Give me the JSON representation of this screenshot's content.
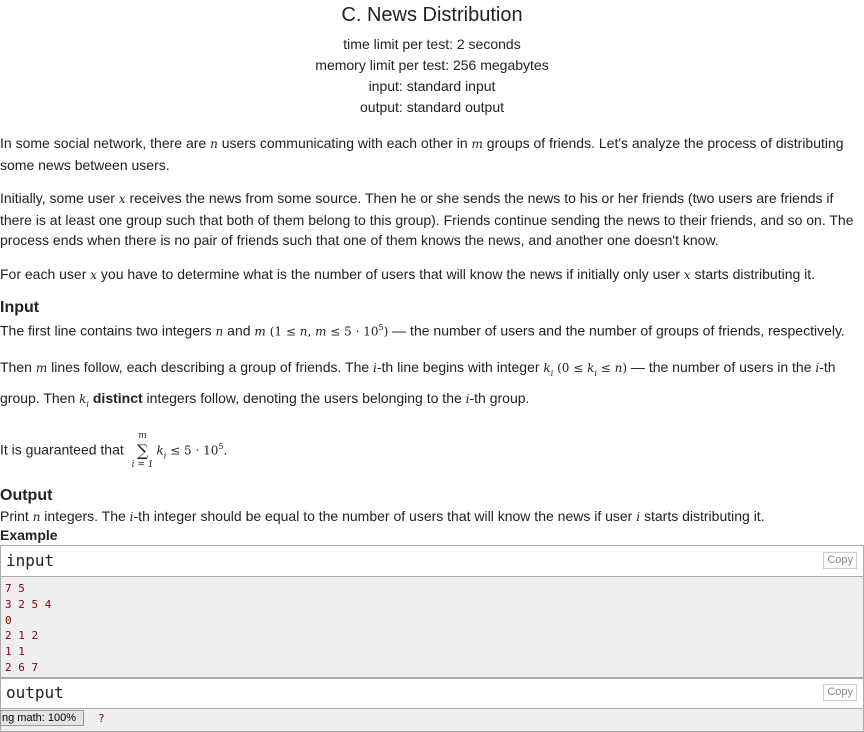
{
  "problem": {
    "title": "C. News Distribution",
    "limits": [
      "time limit per test: 2 seconds",
      "memory limit per test: 256 megabytes",
      "input: standard input",
      "output: standard output"
    ]
  },
  "statement": {
    "p1a": "In some social network, there are ",
    "var_n": "n",
    "p1b": " users communicating with each other in ",
    "var_m": "m",
    "p1c": " groups of friends. Let's analyze the process of distributing some news between users.",
    "p2a": "Initially, some user ",
    "var_x": "x",
    "p2b": " receives the news from some source. Then he or she sends the news to his or her friends (two users are friends if there is at least one group such that both of them belong to this group). Friends continue sending the news to their friends, and so on. The process ends when there is no pair of friends such that one of them knows the news, and another one doesn't know.",
    "p3a": "For each user ",
    "p3b": " you have to determine what is the number of users that will know the news if initially only user ",
    "p3c": " starts distributing it."
  },
  "input_section": {
    "title": "Input",
    "l1a": "The first line contains two integers ",
    "l1b": " and ",
    "l1_constraint_a": "(1 ≤ ",
    "l1_constraint_b": "n",
    "l1_constraint_c": ", ",
    "l1_constraint_d": "m",
    "l1_constraint_e": " ≤ 5 · 10",
    "l1_constraint_exp": "5",
    "l1_constraint_f": ")",
    "l1c": " — the number of users and the number of groups of friends, respectively.",
    "l2a": "Then ",
    "l2b": " lines follow, each describing a group of friends. The ",
    "var_i": "i",
    "l2c": "-th line begins with integer ",
    "var_k": "k",
    "sub_i": "i",
    "l2_constraint_a": " (0 ≤ ",
    "l2_constraint_b": " ≤ ",
    "l2_constraint_c": ")",
    "l2d": " — the number of users in the ",
    "l2e": "-th group. Then ",
    "l2_bold": "distinct",
    "l2f": " integers follow, denoting the users belonging to the ",
    "l2g": "-th group.",
    "l3a": "It is guaranteed that ",
    "sum_top": "m",
    "sum_sym": "∑",
    "sum_bottom": "i = 1",
    "l3_rest": " ≤ 5 · 10",
    "l3_exp": "5",
    "l3_end": "."
  },
  "output_section": {
    "title": "Output",
    "l1a": "Print ",
    "l1b": " integers. The ",
    "l1c": "-th integer should be equal to the number of users that will know the news if user ",
    "l1d": " starts distributing it."
  },
  "example": {
    "title": "Example",
    "input_label": "input",
    "output_label": "output",
    "copy_label": "Copy",
    "input_lines": [
      "7 5",
      "3 2 5 4",
      "0",
      "2 1 2",
      "1 1",
      "2 6 7"
    ],
    "output_visible": "?"
  },
  "mathjax_status": "ng math: 100%"
}
